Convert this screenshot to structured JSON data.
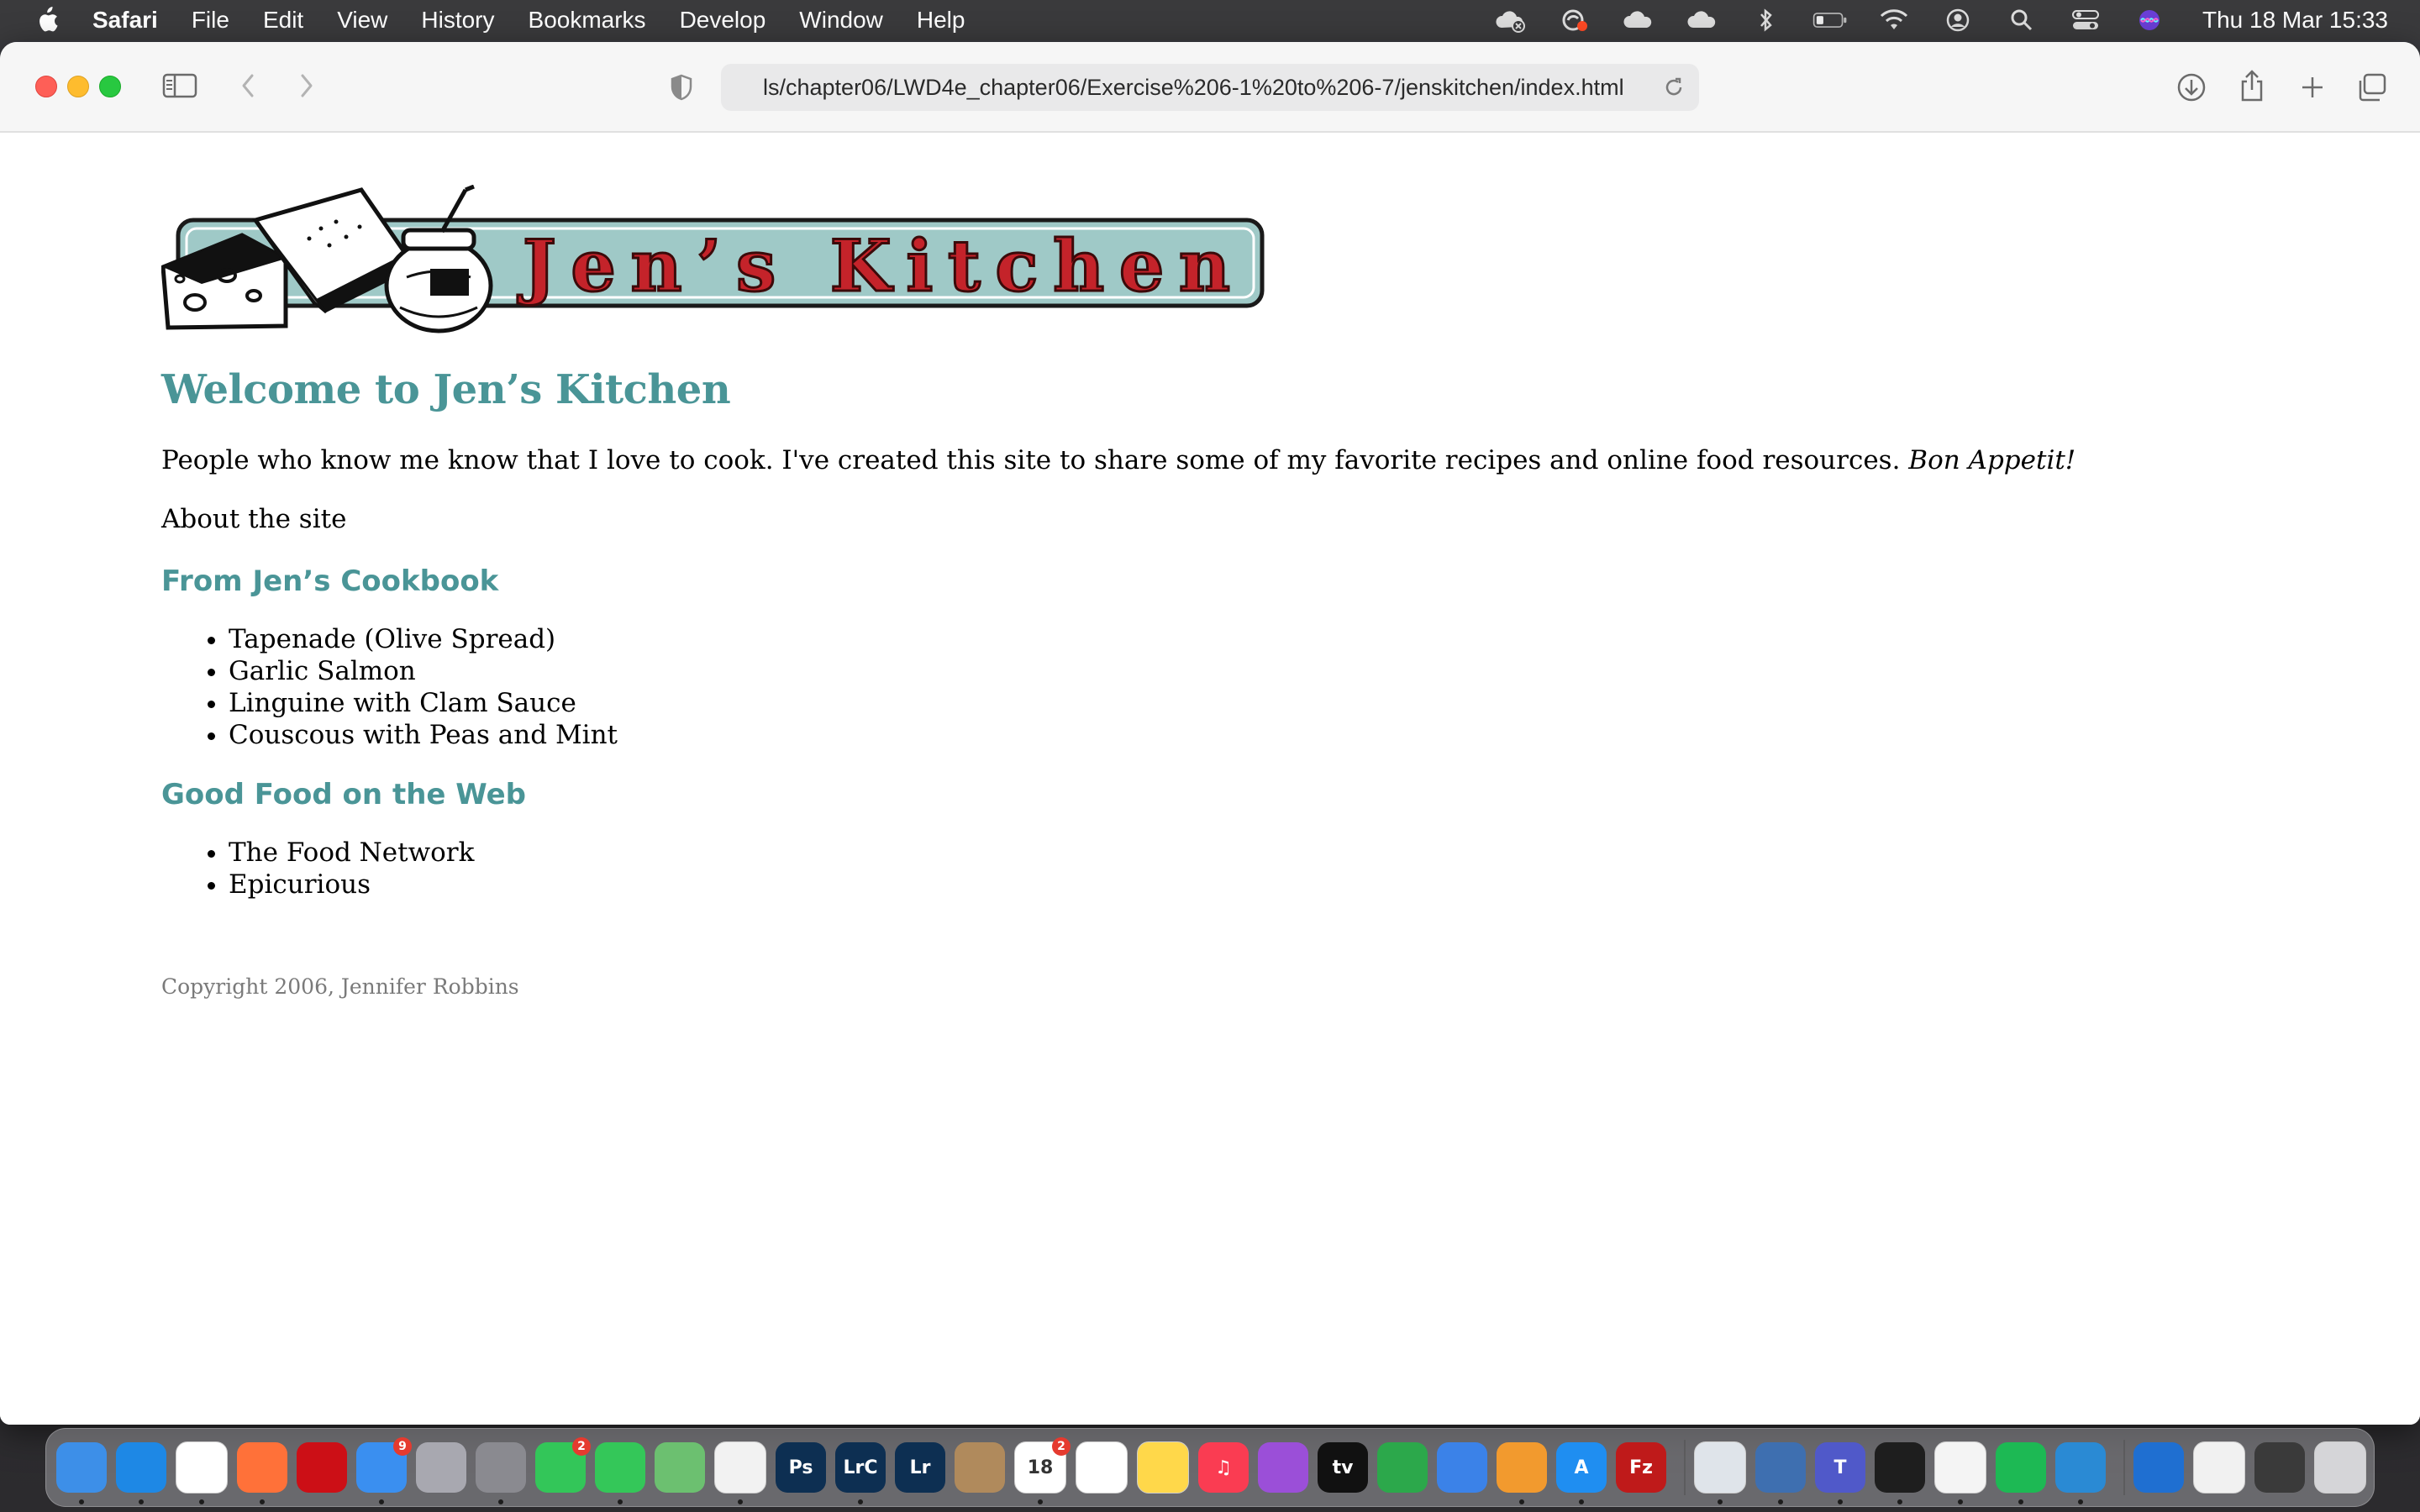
{
  "menubar": {
    "app_name": "Safari",
    "menus": [
      "File",
      "Edit",
      "View",
      "History",
      "Bookmarks",
      "Develop",
      "Window",
      "Help"
    ],
    "status_icons": [
      "creative-cloud-icon",
      "adobe-sync-icon",
      "cloud-icon",
      "icloud-icon",
      "bluetooth-icon",
      "battery-icon",
      "wifi-icon",
      "user-icon",
      "spotlight-search-icon",
      "control-center-icon",
      "siri-icon"
    ],
    "clock": "Thu 18 Mar  15:33"
  },
  "browser": {
    "url": "ls/chapter06/LWD4e_chapter06/Exercise%206-1%20to%206-7/jenskitchen/index.html"
  },
  "page": {
    "logo_text": "Jen’s Kitchen",
    "heading": "Welcome to Jen’s Kitchen",
    "intro_text": "People who know me know that I love to cook. I've created this site to share some of my favorite recipes and online food resources. ",
    "intro_emphasis": "Bon Appetit!",
    "about": "About the site",
    "cookbook_heading": "From Jen’s Cookbook",
    "cookbook_items": [
      "Tapenade (Olive Spread)",
      "Garlic Salmon",
      "Linguine with Clam Sauce",
      "Couscous with Peas and Mint"
    ],
    "web_heading": "Good Food on the Web",
    "web_items": [
      "The Food Network",
      "Epicurious"
    ],
    "copyright": "Copyright 2006, Jennifer Robbins"
  },
  "dock": {
    "apps": [
      {
        "name": "finder",
        "label": "",
        "color": "#3d8fe8"
      },
      {
        "name": "safari",
        "label": "",
        "color": "#1e88e5"
      },
      {
        "name": "chrome",
        "label": "",
        "color": "#ffffff"
      },
      {
        "name": "firefox",
        "label": "",
        "color": "#ff7139"
      },
      {
        "name": "opera",
        "label": "",
        "color": "#cc0f16"
      },
      {
        "name": "mail",
        "label": "",
        "color": "#3a8ff0",
        "badge": "9"
      },
      {
        "name": "launchpad",
        "label": "",
        "color": "#a8a8b0"
      },
      {
        "name": "system-preferences",
        "label": "",
        "color": "#8a8a90"
      },
      {
        "name": "facetime",
        "label": "",
        "color": "#33c659",
        "badge": "2"
      },
      {
        "name": "messages",
        "label": "",
        "color": "#34c759"
      },
      {
        "name": "maps",
        "label": "",
        "color": "#6cc070"
      },
      {
        "name": "photos",
        "label": "",
        "color": "#f2f2f2"
      },
      {
        "name": "photoshop",
        "label": "Ps",
        "color": "#0d2f52"
      },
      {
        "name": "lightroom-classic",
        "label": "LrC",
        "color": "#0d2f52"
      },
      {
        "name": "lightroom",
        "label": "Lr",
        "color": "#0d2f52"
      },
      {
        "name": "contacts",
        "label": "",
        "color": "#b08a5c"
      },
      {
        "name": "calendar",
        "label": "18",
        "color": "#ffffff",
        "badge": "2"
      },
      {
        "name": "reminders",
        "label": "",
        "color": "#ffffff"
      },
      {
        "name": "notes",
        "label": "",
        "color": "#ffd84a"
      },
      {
        "name": "music",
        "label": "♫",
        "color": "#fa3c52"
      },
      {
        "name": "podcasts",
        "label": "",
        "color": "#9b4fd8"
      },
      {
        "name": "apple-tv",
        "label": "tv",
        "color": "#111111"
      },
      {
        "name": "numbers",
        "label": "",
        "color": "#2ca84b"
      },
      {
        "name": "keynote",
        "label": "",
        "color": "#3b82e8"
      },
      {
        "name": "pages",
        "label": "",
        "color": "#f29a2e"
      },
      {
        "name": "app-store",
        "label": "A",
        "color": "#1f8ef1"
      },
      {
        "name": "filezilla",
        "label": "Fz",
        "color": "#bf1a1a"
      },
      {
        "name": "preview",
        "label": "",
        "color": "#dfe4ea"
      },
      {
        "name": "virtualbox",
        "label": "",
        "color": "#3e6fb0"
      },
      {
        "name": "teams",
        "label": "T",
        "color": "#5059c9"
      },
      {
        "name": "activity-monitor",
        "label": "",
        "color": "#1e1e1e"
      },
      {
        "name": "textedit",
        "label": "",
        "color": "#f4f4f4"
      },
      {
        "name": "spotify",
        "label": "",
        "color": "#1db954"
      },
      {
        "name": "vscode",
        "label": "",
        "color": "#2a8ad4"
      },
      {
        "name": "xcode",
        "label": "",
        "color": "#1f6fd1"
      },
      {
        "name": "window-thumb-1",
        "label": "",
        "color": "#f1f1f1"
      },
      {
        "name": "window-thumb-2",
        "label": "",
        "color": "#3a3a3a"
      },
      {
        "name": "trash",
        "label": "",
        "color": "#d5d5d8"
      }
    ]
  }
}
